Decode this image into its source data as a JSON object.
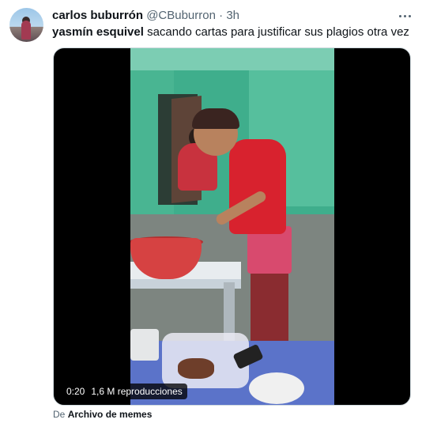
{
  "tweet": {
    "display_name": "carlos buburrón",
    "handle": "@CBuburron",
    "separator": "·",
    "timestamp": "3h",
    "text_bold": "yasmín esquivel",
    "text_rest": " sacando cartas para justificar sus plagios otra vez",
    "more_icon": "ellipsis-icon"
  },
  "video": {
    "duration": "0:20",
    "views": "1,6 M reproducciones"
  },
  "attribution": {
    "prefix": "De",
    "source_name": "Archivo de memes"
  },
  "colors": {
    "text_primary": "#0f1419",
    "text_secondary": "#536471",
    "video_bg": "#000000"
  }
}
